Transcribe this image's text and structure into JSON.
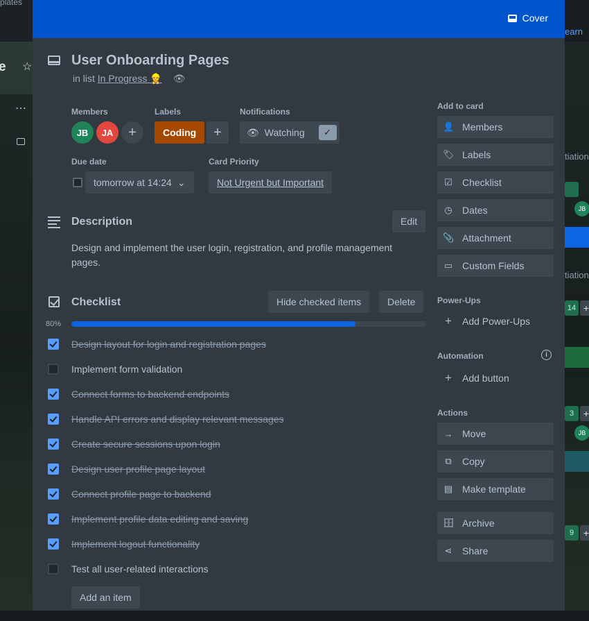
{
  "background": {
    "top_fragment": "plates",
    "left_fragment": "e",
    "right_learn": "earn",
    "right_frag_1": "tiation",
    "right_frag_2": "tiation",
    "right_chip_1": "14",
    "right_chip_2": "3",
    "right_chip_3": "9",
    "right_avatar": "JB"
  },
  "cover": {
    "label": "Cover"
  },
  "card": {
    "title": "User Onboarding Pages",
    "in_list_prefix": "in list",
    "list_name": "In Progress 👷",
    "members_label": "Members",
    "members": [
      {
        "initials": "JB",
        "color": "#1f845a"
      },
      {
        "initials": "JA",
        "color": "#e2483d"
      }
    ],
    "labels_label": "Labels",
    "label_chip": "Coding",
    "notifications_label": "Notifications",
    "watching": "Watching",
    "due_label": "Due date",
    "due_value": "tomorrow at 14:24",
    "priority_label": "Card Priority",
    "priority_value": "Not Urgent but Important"
  },
  "description": {
    "heading": "Description",
    "edit": "Edit",
    "text": "Design and implement the user login, registration, and profile management pages."
  },
  "checklist": {
    "heading": "Checklist",
    "hide_checked": "Hide checked items",
    "delete": "Delete",
    "progress_label": "80%",
    "progress": 0.8,
    "items": [
      {
        "text": "Design layout for login and registration pages",
        "done": true
      },
      {
        "text": "Implement form validation",
        "done": false
      },
      {
        "text": "Connect forms to backend endpoints",
        "done": true
      },
      {
        "text": "Handle API errors and display relevant messages",
        "done": true
      },
      {
        "text": "Create secure sessions upon login",
        "done": true
      },
      {
        "text": "Design user profile page layout",
        "done": true
      },
      {
        "text": "Connect profile page to backend",
        "done": true
      },
      {
        "text": "Implement profile data editing and saving",
        "done": true
      },
      {
        "text": "Implement logout functionality",
        "done": true
      },
      {
        "text": "Test all user-related interactions",
        "done": false
      }
    ],
    "add_item": "Add an item"
  },
  "sidebar": {
    "add_to_card": "Add to card",
    "add_items": [
      "Members",
      "Labels",
      "Checklist",
      "Dates",
      "Attachment",
      "Custom Fields"
    ],
    "powerups_label": "Power-Ups",
    "add_powerups": "Add Power-Ups",
    "automation_label": "Automation",
    "add_button": "Add button",
    "actions_label": "Actions",
    "actions": [
      "Move",
      "Copy",
      "Make template",
      "Archive",
      "Share"
    ]
  }
}
